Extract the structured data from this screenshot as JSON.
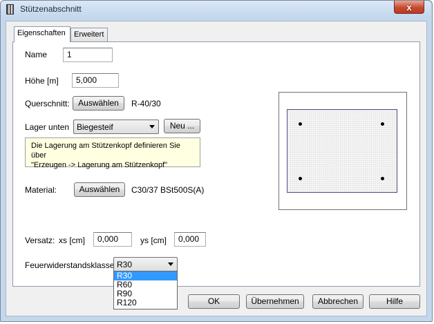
{
  "window": {
    "title": "Stützenabschnitt",
    "close_glyph": "x"
  },
  "tabs": [
    {
      "label": "Eigenschaften",
      "active": true
    },
    {
      "label": "Erweitert",
      "active": false
    }
  ],
  "form": {
    "name_label": "Name",
    "name_value": "1",
    "height_label": "Höhe [m]",
    "height_value": "5,000",
    "section_label": "Querschnitt:",
    "section_button": "Auswählen",
    "section_value": "R-40/30",
    "support_label": "Lager unten",
    "support_value": "Biegesteif",
    "new_button": "Neu ...",
    "info_line1": "Die Lagerung am Stützenkopf definieren Sie über",
    "info_line2": "\"Erzeugen -> Lagerung am Stützenkopf\"",
    "material_label": "Material:",
    "material_button": "Auswählen",
    "material_value": "C30/37 BSt500S(A)",
    "offset_label": "Versatz:",
    "xs_label": "xs [cm]",
    "xs_value": "0,000",
    "ys_label": "ys [cm]",
    "ys_value": "0,000",
    "fire_label": "Feuerwiderstandsklasse",
    "fire_value": "R30",
    "fire_options": [
      "R30",
      "R60",
      "R90",
      "R120"
    ]
  },
  "buttons": {
    "ok": "OK",
    "apply": "Übernehmen",
    "cancel": "Abbrechen",
    "help": "Hilfe"
  },
  "colors": {
    "selection": "#3399ff",
    "info_background": "#ffffe1",
    "close_button": "#c74a33"
  }
}
